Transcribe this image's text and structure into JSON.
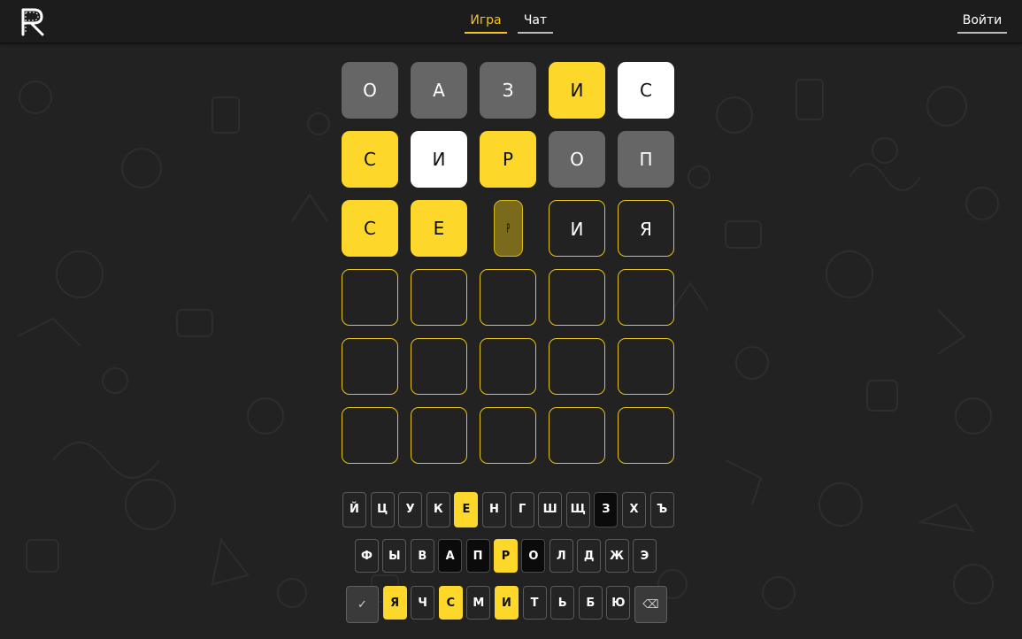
{
  "header": {
    "logo_letter": "R",
    "tabs": [
      {
        "label": "Игра",
        "active": true
      },
      {
        "label": "Чат",
        "active": false
      }
    ],
    "login_label": "Войти"
  },
  "colors": {
    "accent": "#f5c518",
    "tile_yellow": "#fdd82a",
    "tile_gray": "#666666",
    "tile_white": "#ffffff",
    "background": "#222222"
  },
  "board": {
    "rows": [
      [
        {
          "letter": "О",
          "state": "gray"
        },
        {
          "letter": "А",
          "state": "gray"
        },
        {
          "letter": "З",
          "state": "gray"
        },
        {
          "letter": "И",
          "state": "yellow"
        },
        {
          "letter": "С",
          "state": "white"
        }
      ],
      [
        {
          "letter": "С",
          "state": "yellow"
        },
        {
          "letter": "И",
          "state": "white"
        },
        {
          "letter": "Р",
          "state": "yellow"
        },
        {
          "letter": "О",
          "state": "gray"
        },
        {
          "letter": "П",
          "state": "gray"
        }
      ],
      [
        {
          "letter": "С",
          "state": "yellow"
        },
        {
          "letter": "Е",
          "state": "yellow"
        },
        {
          "letter": "Р",
          "state": "flipping"
        },
        {
          "letter": "И",
          "state": "empty"
        },
        {
          "letter": "Я",
          "state": "empty"
        }
      ],
      [
        {
          "letter": "",
          "state": "empty"
        },
        {
          "letter": "",
          "state": "empty"
        },
        {
          "letter": "",
          "state": "empty"
        },
        {
          "letter": "",
          "state": "empty"
        },
        {
          "letter": "",
          "state": "empty"
        }
      ],
      [
        {
          "letter": "",
          "state": "empty"
        },
        {
          "letter": "",
          "state": "empty"
        },
        {
          "letter": "",
          "state": "empty"
        },
        {
          "letter": "",
          "state": "empty"
        },
        {
          "letter": "",
          "state": "empty"
        }
      ],
      [
        {
          "letter": "",
          "state": "empty"
        },
        {
          "letter": "",
          "state": "empty"
        },
        {
          "letter": "",
          "state": "empty"
        },
        {
          "letter": "",
          "state": "empty"
        },
        {
          "letter": "",
          "state": "empty"
        }
      ]
    ]
  },
  "keyboard": {
    "rows": [
      [
        {
          "k": "Й",
          "s": "default"
        },
        {
          "k": "Ц",
          "s": "default"
        },
        {
          "k": "У",
          "s": "default"
        },
        {
          "k": "К",
          "s": "default"
        },
        {
          "k": "Е",
          "s": "yellow"
        },
        {
          "k": "Н",
          "s": "default"
        },
        {
          "k": "Г",
          "s": "default"
        },
        {
          "k": "Ш",
          "s": "default"
        },
        {
          "k": "Щ",
          "s": "default"
        },
        {
          "k": "З",
          "s": "black"
        },
        {
          "k": "Х",
          "s": "default"
        },
        {
          "k": "Ъ",
          "s": "default"
        }
      ],
      [
        {
          "k": "Ф",
          "s": "default"
        },
        {
          "k": "Ы",
          "s": "default"
        },
        {
          "k": "В",
          "s": "default"
        },
        {
          "k": "А",
          "s": "black"
        },
        {
          "k": "П",
          "s": "black"
        },
        {
          "k": "Р",
          "s": "yellow"
        },
        {
          "k": "О",
          "s": "black"
        },
        {
          "k": "Л",
          "s": "default"
        },
        {
          "k": "Д",
          "s": "default"
        },
        {
          "k": "Ж",
          "s": "default"
        },
        {
          "k": "Э",
          "s": "default"
        }
      ],
      [
        {
          "k": "✓",
          "s": "wide",
          "name": "submit-key"
        },
        {
          "k": "Я",
          "s": "yellow"
        },
        {
          "k": "Ч",
          "s": "default"
        },
        {
          "k": "С",
          "s": "yellow"
        },
        {
          "k": "М",
          "s": "default"
        },
        {
          "k": "И",
          "s": "yellow"
        },
        {
          "k": "Т",
          "s": "default"
        },
        {
          "k": "Ь",
          "s": "default"
        },
        {
          "k": "Б",
          "s": "default"
        },
        {
          "k": "Ю",
          "s": "default"
        },
        {
          "k": "⌫",
          "s": "wide",
          "name": "backspace-key"
        }
      ]
    ]
  }
}
